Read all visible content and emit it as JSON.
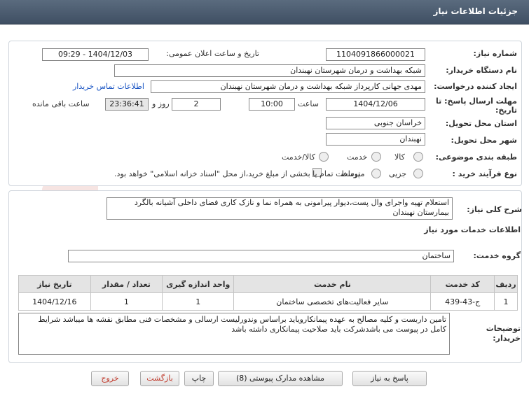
{
  "header": {
    "title": "جزئیات اطلاعات نیاز"
  },
  "form": {
    "need_number_label": "شماره نیاز:",
    "need_number": "1104091866000021",
    "announce_label": "تاریخ و ساعت اعلان عمومی:",
    "announce_value": "1404/12/03 - 09:29",
    "buyer_label": "نام دستگاه خریدار:",
    "buyer_value": "شبکه بهداشت و درمان شهرستان نهبندان",
    "creator_label": "ایجاد کننده درخواست:",
    "creator_value": "مهدی جهانی کارپرداز شبکه بهداشت و درمان شهرستان نهبندان",
    "contact_link": "اطلاعات تماس خریدار",
    "deadline_label": "مهلت ارسال پاسخ: تا تاریخ:",
    "deadline_date": "1404/12/06",
    "time_label": "ساعت",
    "deadline_time": "10:00",
    "days_value": "2",
    "days_label": "روز و",
    "remaining_value": "23:36:41",
    "remaining_label": "ساعت باقی مانده",
    "province_label": "استان محل تحویل:",
    "province_value": "خراسان جنوبی",
    "city_label": "شهر محل تحویل:",
    "city_value": "نهبندان",
    "category_label": "طبقه بندی موضوعی:",
    "category_options": [
      "کالا",
      "خدمت",
      "کالا/خدمت"
    ],
    "process_label": "نوع فرآیند خرید :",
    "process_options": [
      "جزیی",
      "متوسط"
    ],
    "process_note": "پرداخت تمام یا بخشی از مبلغ خرید،از محل \"اسناد خزانه اسلامی\" خواهد بود."
  },
  "description": {
    "label": "شرح کلی نیاز:",
    "value": "استعلام تهیه واجرای وال پست،دیوار پیرامونی به همراه نما و نازک کاری فضای داخلی آشیانه بالگرد بیمارستان نهبندان",
    "services_title": "اطلاعات خدمات مورد نیاز",
    "group_label": "گروه خدمت:",
    "group_value": "ساختمان"
  },
  "table": {
    "headers": [
      "ردیف",
      "کد خدمت",
      "نام خدمت",
      "واحد اندازه گیری",
      "تعداد / مقدار",
      "تاریخ نیاز"
    ],
    "rows": [
      [
        "1",
        "ج-43-439",
        "سایر فعالیت‌های تخصصی ساختمان",
        "1",
        "1",
        "1404/12/16"
      ]
    ]
  },
  "notes": {
    "label": "توضیحات خریدار:",
    "value": "تامین داربست و کلیه مصالح به عهده پیمانکارویاید براساس وندورلیست ارسالی و مشخصات فنی مطابق نقشه ها میباشد شرایط کامل در پیوست می باشدشرکت باید صلاحیت پیمانکاری داشته باشد"
  },
  "buttons": {
    "reply": "پاسخ به نیاز",
    "attachments": "مشاهده مدارک پیوستی (8)",
    "print": "چاپ",
    "back": "بازگشت",
    "exit": "خروج"
  },
  "watermark": {
    "text": "AriaTender.net"
  },
  "colors": {
    "header": "#4a5a6d",
    "link": "#1a55c4",
    "exit": "#c0392b"
  }
}
